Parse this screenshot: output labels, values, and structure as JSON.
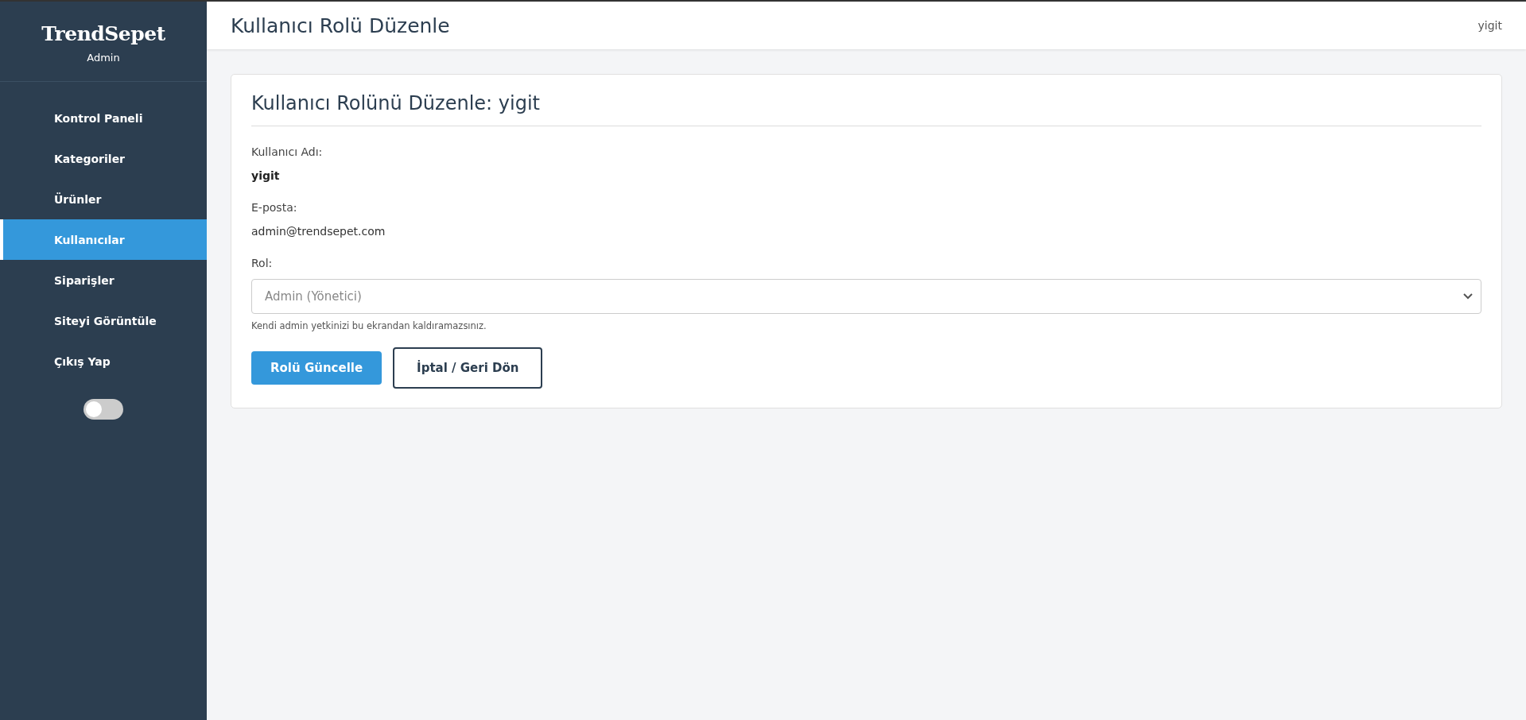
{
  "sidebar": {
    "brand": "TrendSepet",
    "subtitle": "Admin",
    "items": [
      {
        "label": "Kontrol Paneli",
        "selected": false
      },
      {
        "label": "Kategoriler",
        "selected": false
      },
      {
        "label": "Ürünler",
        "selected": false
      },
      {
        "label": "Kullanıcılar",
        "selected": true
      },
      {
        "label": "Siparişler",
        "selected": false
      },
      {
        "label": "Siteyi Görüntüle",
        "selected": false
      },
      {
        "label": "Çıkış Yap",
        "selected": false
      }
    ],
    "theme_toggle": {
      "on": false
    }
  },
  "header": {
    "title": "Kullanıcı Rolü Düzenle",
    "user": "yigit"
  },
  "card": {
    "title": "Kullanıcı Rolünü Düzenle: yigit",
    "username_label": "Kullanıcı Adı:",
    "username": "yigit",
    "email_label": "E-posta:",
    "email": "admin@trendsepet.com",
    "role_label": "Rol:",
    "role": {
      "value": "Admin (Yönetici)",
      "disabled": true
    },
    "hint": "Kendi admin yetkinizi bu ekrandan kaldıramazsınız.",
    "buttons": [
      {
        "label": "Rolü Güncelle",
        "kind": "primary"
      },
      {
        "label": "İptal / Geri Dön",
        "kind": "outline"
      }
    ]
  }
}
